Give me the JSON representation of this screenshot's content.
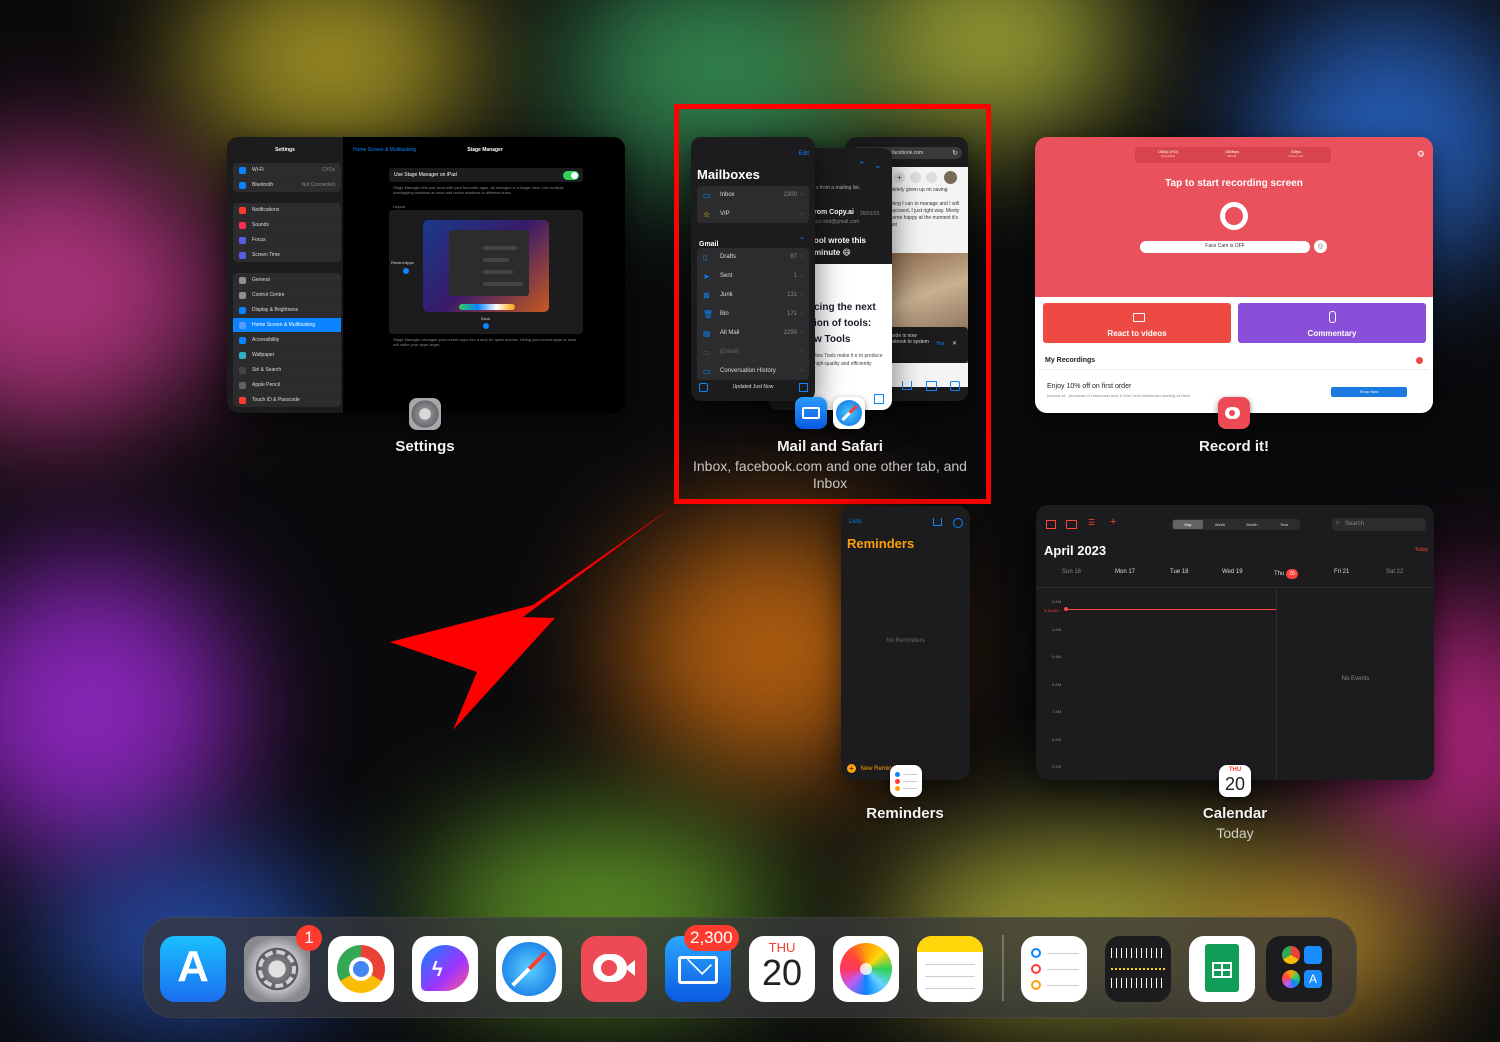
{
  "cards": {
    "settings": {
      "label": "Settings",
      "screen": {
        "sidebar_title": "Settings",
        "back_link": "Home Screen & Multitasking",
        "detail_title": "Stage Manager",
        "toggle_label": "Use Stage Manager on iPad",
        "detail_desc": "Stage Manager lets you work with your favourite apps, all arranged in a single view. Use multiple overlapping windows at once and resize windows to different sizes.",
        "layout_label": "Layout",
        "recent_apps": "Recent Apps",
        "dock": "Dock",
        "footer_desc": "Stage Manager arranges your recent apps into a strip for quick access. Hiding your recent apps or dock will make your apps larger.",
        "items_a": [
          {
            "label": "Wi-Fi",
            "value": "CXOs",
            "color": "#0a84ff"
          },
          {
            "label": "Bluetooth",
            "value": "Not Connected",
            "color": "#0a84ff"
          }
        ],
        "items_b": [
          {
            "label": "Notifications",
            "color": "#ff3b30"
          },
          {
            "label": "Sounds",
            "color": "#ff2d55"
          },
          {
            "label": "Focus",
            "color": "#5e5ce6"
          },
          {
            "label": "Screen Time",
            "color": "#5e5ce6"
          }
        ],
        "items_c": [
          {
            "label": "General",
            "color": "#8e8e93"
          },
          {
            "label": "Control Centre",
            "color": "#8e8e93"
          },
          {
            "label": "Display & Brightness",
            "color": "#0a84ff"
          },
          {
            "label": "Home Screen & Multitasking",
            "color": "#0a84ff"
          },
          {
            "label": "Accessibility",
            "color": "#0a84ff"
          },
          {
            "label": "Wallpaper",
            "color": "#30b0c7"
          },
          {
            "label": "Siri & Search",
            "color": "#444"
          },
          {
            "label": "Apple Pencil",
            "color": "#636366"
          },
          {
            "label": "Touch ID & Passcode",
            "color": "#ff3b30"
          }
        ]
      }
    },
    "mail_safari": {
      "label": "Mail and Safari",
      "subtitle": "Inbox, facebook.com and one other tab, and Inbox",
      "mail": {
        "edit": "Edit",
        "title": "Mailboxes",
        "gmail": "Gmail",
        "updated": "Updated Just Now",
        "top_rows": [
          {
            "label": "Inbox",
            "count": "2300",
            "icon": "▭"
          },
          {
            "label": "VIP",
            "count": "",
            "icon": "☆"
          }
        ],
        "gmail_rows": [
          {
            "label": "Drafts",
            "count": "87",
            "icon": "▯"
          },
          {
            "label": "Sent",
            "count": "1",
            "icon": "➤"
          },
          {
            "label": "Junk",
            "count": "131",
            "icon": "⊠"
          },
          {
            "label": "Bin",
            "count": "171",
            "icon": "🗑"
          },
          {
            "label": "All Mail",
            "count": "2299",
            "icon": "▤"
          },
          {
            "label": "[Gmail]",
            "count": "",
            "icon": "▭"
          },
          {
            "label": "Conversation History",
            "count": "",
            "icon": "▭"
          }
        ]
      },
      "mail_msg": {
        "line1": "s from a mailing list.",
        "from": "rom Copy.ai",
        "date": "26/01/23",
        "email": "ai.ir.sbd@gmail.com",
        "headline_a": "ool wrote this",
        "headline_b": "minute 😄",
        "big_a": "cing the next",
        "big_b": "ion of tools:",
        "big_c": "w Tools",
        "body": "flow Tools make it e to produce high-quality and efficiently"
      },
      "safari": {
        "url": "facebook.com",
        "text1": "pletely given up on saving",
        "text2": "thing I can to manage and I will succeed, I just right way. Monty some happy at the moment it's not",
        "popup": "node is now cebook to system",
        "popup_action": "Yes"
      }
    },
    "record": {
      "label": "Record it!",
      "top_opts": [
        {
          "t": "1080p (HD)",
          "s": "Resolution"
        },
        {
          "t": "16Mbps",
          "s": "Bitrate"
        },
        {
          "t": "30fps",
          "s": "Frame rate"
        }
      ],
      "title": "Tap to start recording screen",
      "facecam": "Face Cam is OFF",
      "react": "React to videos",
      "commentary": "Commentary",
      "my_recordings": "My Recordings",
      "ad_title": "Enjoy 10% off on first order",
      "ad_sub": "Infused oil - proceeds of Harkamski Acid & Aloe Vera Moisturizer starting at Hello",
      "ad_cta": "Shop Now"
    },
    "reminders": {
      "label": "Reminders",
      "back": "Lists",
      "title": "Reminders",
      "empty": "No Reminders",
      "new": "New Reminder"
    },
    "calendar": {
      "label": "Calendar",
      "subtitle": "Today",
      "icon_day": "THU",
      "icon_date": "20",
      "views": [
        "Day",
        "Week",
        "Month",
        "Year"
      ],
      "search": "Search",
      "month": "April 2023",
      "today": "Today",
      "days": [
        "Sun 16",
        "Mon 17",
        "Tue 18",
        "Wed 19",
        "Thu",
        "Fri 21",
        "Sat 22"
      ],
      "thu_num": "20",
      "times": [
        "3 AM",
        "3:18 AM",
        "4 AM",
        "5 AM",
        "6 AM",
        "7 AM",
        "8 AM",
        "9 AM"
      ],
      "no_events": "No Events"
    }
  },
  "dock": {
    "settings_badge": "1",
    "mail_badge": "2,300",
    "calendar_day": "THU",
    "calendar_date": "20"
  },
  "colors": {
    "highlight": "#ff0000",
    "record_bg": "#e9525c",
    "reminders_accent": "#ff9f0a"
  }
}
